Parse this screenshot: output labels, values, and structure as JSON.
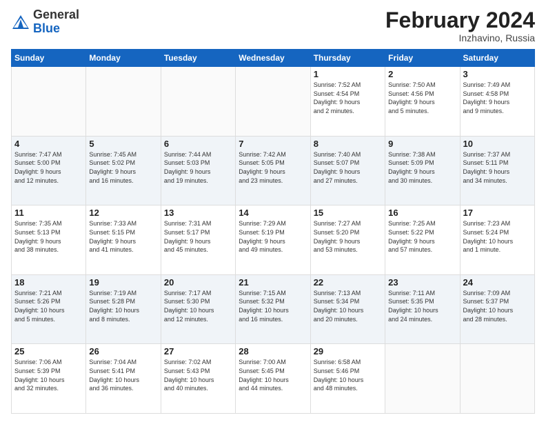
{
  "header": {
    "logo": {
      "general": "General",
      "blue": "Blue"
    },
    "title": "February 2024",
    "location": "Inzhavino, Russia"
  },
  "days_of_week": [
    "Sunday",
    "Monday",
    "Tuesday",
    "Wednesday",
    "Thursday",
    "Friday",
    "Saturday"
  ],
  "weeks": [
    [
      {
        "day": "",
        "info": ""
      },
      {
        "day": "",
        "info": ""
      },
      {
        "day": "",
        "info": ""
      },
      {
        "day": "",
        "info": ""
      },
      {
        "day": "1",
        "info": "Sunrise: 7:52 AM\nSunset: 4:54 PM\nDaylight: 9 hours\nand 2 minutes."
      },
      {
        "day": "2",
        "info": "Sunrise: 7:50 AM\nSunset: 4:56 PM\nDaylight: 9 hours\nand 5 minutes."
      },
      {
        "day": "3",
        "info": "Sunrise: 7:49 AM\nSunset: 4:58 PM\nDaylight: 9 hours\nand 9 minutes."
      }
    ],
    [
      {
        "day": "4",
        "info": "Sunrise: 7:47 AM\nSunset: 5:00 PM\nDaylight: 9 hours\nand 12 minutes."
      },
      {
        "day": "5",
        "info": "Sunrise: 7:45 AM\nSunset: 5:02 PM\nDaylight: 9 hours\nand 16 minutes."
      },
      {
        "day": "6",
        "info": "Sunrise: 7:44 AM\nSunset: 5:03 PM\nDaylight: 9 hours\nand 19 minutes."
      },
      {
        "day": "7",
        "info": "Sunrise: 7:42 AM\nSunset: 5:05 PM\nDaylight: 9 hours\nand 23 minutes."
      },
      {
        "day": "8",
        "info": "Sunrise: 7:40 AM\nSunset: 5:07 PM\nDaylight: 9 hours\nand 27 minutes."
      },
      {
        "day": "9",
        "info": "Sunrise: 7:38 AM\nSunset: 5:09 PM\nDaylight: 9 hours\nand 30 minutes."
      },
      {
        "day": "10",
        "info": "Sunrise: 7:37 AM\nSunset: 5:11 PM\nDaylight: 9 hours\nand 34 minutes."
      }
    ],
    [
      {
        "day": "11",
        "info": "Sunrise: 7:35 AM\nSunset: 5:13 PM\nDaylight: 9 hours\nand 38 minutes."
      },
      {
        "day": "12",
        "info": "Sunrise: 7:33 AM\nSunset: 5:15 PM\nDaylight: 9 hours\nand 41 minutes."
      },
      {
        "day": "13",
        "info": "Sunrise: 7:31 AM\nSunset: 5:17 PM\nDaylight: 9 hours\nand 45 minutes."
      },
      {
        "day": "14",
        "info": "Sunrise: 7:29 AM\nSunset: 5:19 PM\nDaylight: 9 hours\nand 49 minutes."
      },
      {
        "day": "15",
        "info": "Sunrise: 7:27 AM\nSunset: 5:20 PM\nDaylight: 9 hours\nand 53 minutes."
      },
      {
        "day": "16",
        "info": "Sunrise: 7:25 AM\nSunset: 5:22 PM\nDaylight: 9 hours\nand 57 minutes."
      },
      {
        "day": "17",
        "info": "Sunrise: 7:23 AM\nSunset: 5:24 PM\nDaylight: 10 hours\nand 1 minute."
      }
    ],
    [
      {
        "day": "18",
        "info": "Sunrise: 7:21 AM\nSunset: 5:26 PM\nDaylight: 10 hours\nand 5 minutes."
      },
      {
        "day": "19",
        "info": "Sunrise: 7:19 AM\nSunset: 5:28 PM\nDaylight: 10 hours\nand 8 minutes."
      },
      {
        "day": "20",
        "info": "Sunrise: 7:17 AM\nSunset: 5:30 PM\nDaylight: 10 hours\nand 12 minutes."
      },
      {
        "day": "21",
        "info": "Sunrise: 7:15 AM\nSunset: 5:32 PM\nDaylight: 10 hours\nand 16 minutes."
      },
      {
        "day": "22",
        "info": "Sunrise: 7:13 AM\nSunset: 5:34 PM\nDaylight: 10 hours\nand 20 minutes."
      },
      {
        "day": "23",
        "info": "Sunrise: 7:11 AM\nSunset: 5:35 PM\nDaylight: 10 hours\nand 24 minutes."
      },
      {
        "day": "24",
        "info": "Sunrise: 7:09 AM\nSunset: 5:37 PM\nDaylight: 10 hours\nand 28 minutes."
      }
    ],
    [
      {
        "day": "25",
        "info": "Sunrise: 7:06 AM\nSunset: 5:39 PM\nDaylight: 10 hours\nand 32 minutes."
      },
      {
        "day": "26",
        "info": "Sunrise: 7:04 AM\nSunset: 5:41 PM\nDaylight: 10 hours\nand 36 minutes."
      },
      {
        "day": "27",
        "info": "Sunrise: 7:02 AM\nSunset: 5:43 PM\nDaylight: 10 hours\nand 40 minutes."
      },
      {
        "day": "28",
        "info": "Sunrise: 7:00 AM\nSunset: 5:45 PM\nDaylight: 10 hours\nand 44 minutes."
      },
      {
        "day": "29",
        "info": "Sunrise: 6:58 AM\nSunset: 5:46 PM\nDaylight: 10 hours\nand 48 minutes."
      },
      {
        "day": "",
        "info": ""
      },
      {
        "day": "",
        "info": ""
      }
    ]
  ]
}
